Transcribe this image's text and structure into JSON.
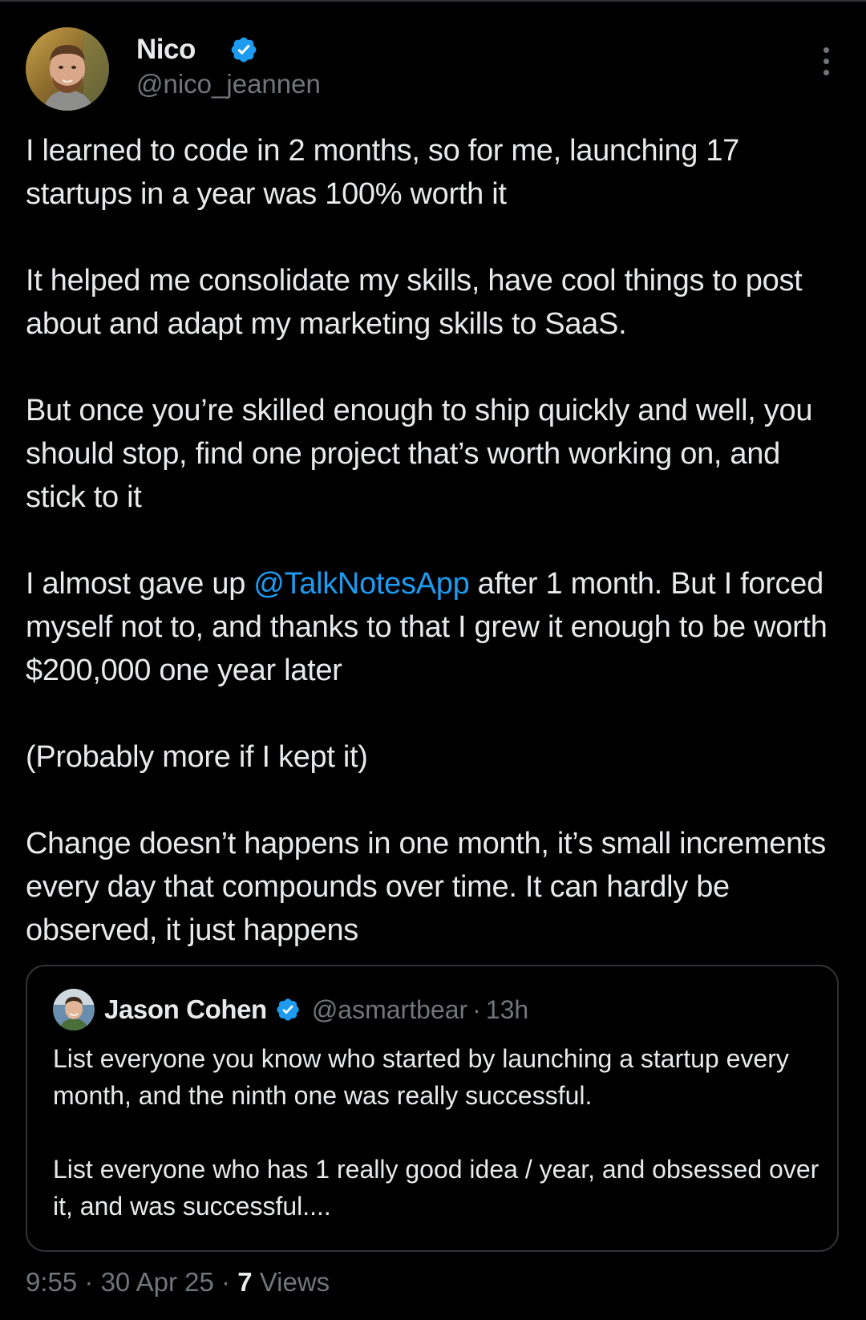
{
  "author": {
    "name": "Nico",
    "handle": "@nico_jeannen",
    "verified": true
  },
  "tweet": {
    "paragraphs": [
      {
        "text": "I learned to code in 2 months, so for me, launching 17 startups in a year was 100% worth it"
      },
      {
        "text": "It helped me consolidate my skills, have cool things to post about and adapt my marketing skills to SaaS."
      },
      {
        "text": "But once you’re skilled enough to ship quickly and well, you should stop, find one project that’s worth working on, and stick to it"
      },
      {
        "before": "I almost gave up ",
        "mention": "@TalkNotesApp",
        "after": " after 1 month. But I forced myself not to, and thanks to that I grew it enough to be worth $200,000 one year later"
      },
      {
        "text": "(Probably more if I kept it)"
      },
      {
        "text": "Change doesn’t happens in one month, it’s small increments every day that compounds over time. It can hardly be observed, it just happens"
      }
    ]
  },
  "quote": {
    "name": "Jason Cohen",
    "handle": "@asmartbear",
    "separator": "·",
    "time": "13h",
    "paragraphs": [
      "List everyone you know who started by launching a startup every month, and the ninth one was really successful.",
      "List everyone who has 1 really good idea / year, and obsessed over it, and was successful...."
    ]
  },
  "meta": {
    "time": "9:55",
    "separator": "·",
    "date": "30 Apr 25",
    "views_count": "7",
    "views_label": "Views"
  },
  "colors": {
    "background": "#000000",
    "text": "#e7e9ea",
    "secondary": "#71767b",
    "accent": "#1d9bf0",
    "border": "#2f3336"
  },
  "icons": {
    "verified": "verified-badge-icon",
    "more": "more-options-icon"
  }
}
